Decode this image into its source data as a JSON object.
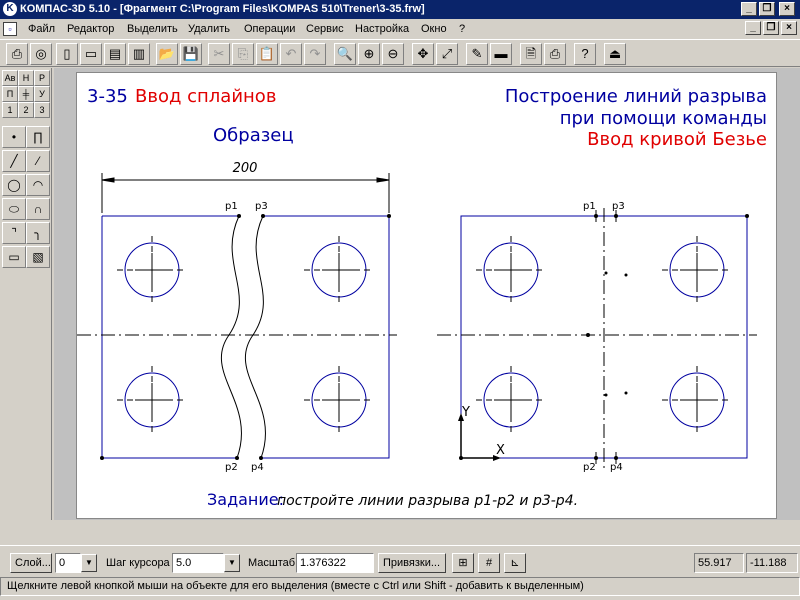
{
  "window": {
    "title": "КОМПАС-3D 5.10 - [Фрагмент C:\\Program Files\\KOMPAS 510\\Trener\\3-35.frw]",
    "minimize_label": "_",
    "restore_label": "❐",
    "close_label": "×"
  },
  "menu": {
    "items": [
      "Файл",
      "Редактор",
      "Выделить",
      "Удалить",
      "Операции",
      "Сервис",
      "Настройка",
      "Окно",
      "?"
    ]
  },
  "toolbar": {
    "buttons": [
      "document-icon",
      "preview-icon",
      "new-document-icon",
      "new-sheet-icon",
      "new-fragment-icon",
      "open-folder-icon",
      "save-icon",
      "cut-icon",
      "copy-icon",
      "paste-icon",
      "undo-icon",
      "redo-icon",
      "zoom-window-icon",
      "zoom-in-icon",
      "zoom-out-icon",
      "pan-icon",
      "zoom-all-icon",
      "refresh-icon",
      "properties-icon",
      "layers-icon",
      "print-preview-icon",
      "print-icon",
      "help-icon",
      "exit-icon"
    ]
  },
  "leftpanel": {
    "small": [
      "Ав",
      "Н",
      "Р",
      "П",
      "╪",
      "У",
      "1",
      "2",
      "3"
    ],
    "tools": [
      "point-tool-icon",
      "spline-tool-icon",
      "segment-tool-icon",
      "polyline-tool-icon",
      "circle-tool-icon",
      "arc-tool-icon",
      "ellipse-tool-icon",
      "bezier-tool-icon",
      "chamfer-tool-icon",
      "fillet-tool-icon",
      "rectangle-tool-icon",
      "hatch-tool-icon"
    ]
  },
  "drawing": {
    "lesson_number": "3-35",
    "lesson_title": "Ввод сплайнов",
    "heading_line1": "Построение линий разрыва",
    "heading_line2": "при помощи команды",
    "heading_line3": "Ввод кривой Безье",
    "sample_label": "Образец",
    "dimension_value": "200",
    "left_points": {
      "p1": "p1",
      "p3": "p3",
      "p2": "p2",
      "p4": "p4"
    },
    "right_points": {
      "p1": "p1",
      "p3": "p3",
      "p2": "p2",
      "p4": "p4"
    },
    "axis_y": "Y",
    "axis_x": "X",
    "task_label": "Задание:",
    "task_text": "постройте линии разрыва p1-p2 и p3-p4."
  },
  "status": {
    "layer_button": "Слой...",
    "layer_value": "0",
    "step_label": "Шаг курсора",
    "step_value": "5.0",
    "scale_label": "Масштаб",
    "scale_value": "1.376322",
    "snap_button": "Привязки...",
    "coord_x": "55.917",
    "coord_y": "-11.188"
  },
  "hint": "Щелкните левой кнопкой мыши на объекте для его выделения (вместе с Ctrl или Shift - добавить к выделенным)",
  "colors": {
    "title_bar": "#0a246a",
    "drawing_blue": "#0000a0",
    "drawing_red": "#e00000",
    "sheet_bg": "#ffffff"
  }
}
